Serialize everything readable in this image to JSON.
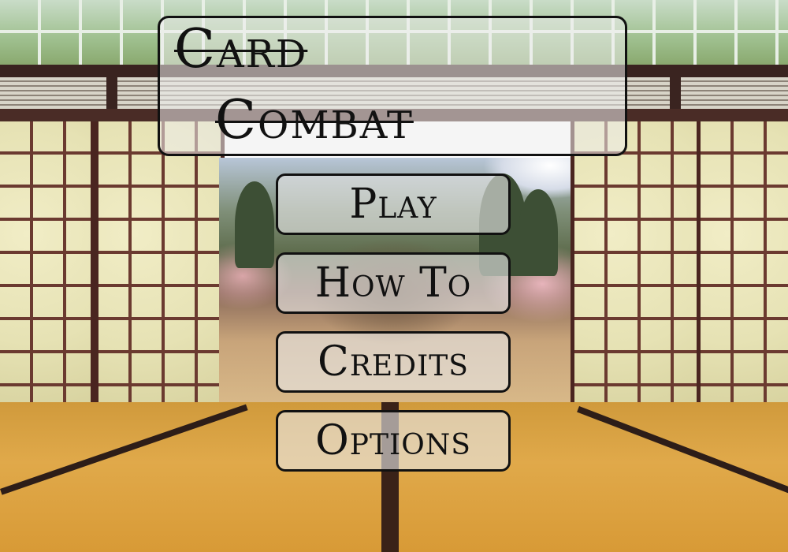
{
  "title": {
    "line1": "Card",
    "line2": "Combat"
  },
  "menu": {
    "items": [
      {
        "label": "Play"
      },
      {
        "label": "How To"
      },
      {
        "label": "Credits"
      },
      {
        "label": "Options"
      }
    ]
  },
  "colors": {
    "panel_border": "#111111",
    "panel_fill": "rgba(236,236,236,0.55)",
    "text": "#111111",
    "floor": "#d89a36",
    "wood": "#4a2520"
  }
}
